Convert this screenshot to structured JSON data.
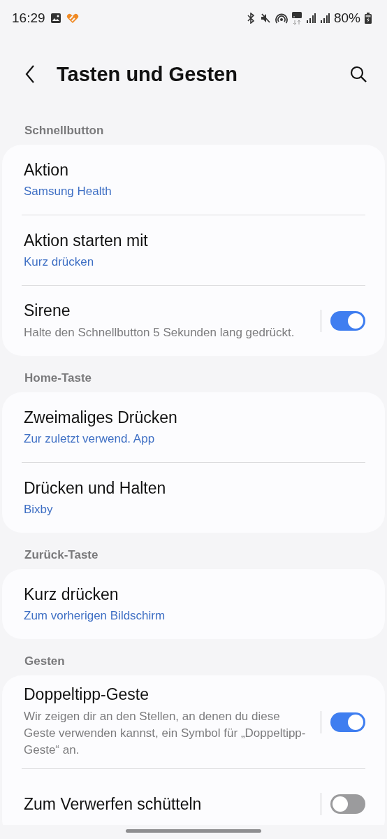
{
  "status_bar": {
    "time": "16:29",
    "battery": "80%"
  },
  "header": {
    "title": "Tasten und Gesten"
  },
  "sections": [
    {
      "title": "Schnellbutton",
      "items": [
        {
          "kind": "value",
          "title": "Aktion",
          "value": "Samsung Health"
        },
        {
          "kind": "value",
          "title": "Aktion starten mit",
          "value": "Kurz drücken"
        },
        {
          "kind": "switch",
          "title": "Sirene",
          "description": "Halte den Schnellbutton 5 Sekunden lang gedrückt.",
          "on": true
        }
      ]
    },
    {
      "title": "Home-Taste",
      "items": [
        {
          "kind": "value",
          "title": "Zweimaliges Drücken",
          "value": "Zur zuletzt verwend. App"
        },
        {
          "kind": "value",
          "title": "Drücken und Halten",
          "value": "Bixby"
        }
      ]
    },
    {
      "title": "Zurück-Taste",
      "items": [
        {
          "kind": "value",
          "title": "Kurz drücken",
          "value": "Zum vorherigen Bildschirm"
        }
      ]
    },
    {
      "title": "Gesten",
      "items": [
        {
          "kind": "switch",
          "title": "Doppeltipp-Geste",
          "description": "Wir zeigen dir an den Stellen, an denen du diese Geste verwenden kannst, ein Symbol für „Doppeltipp-Geste“ an.",
          "on": true
        },
        {
          "kind": "switch",
          "title": "Zum Verwerfen schütteln",
          "on": false
        }
      ]
    }
  ]
}
